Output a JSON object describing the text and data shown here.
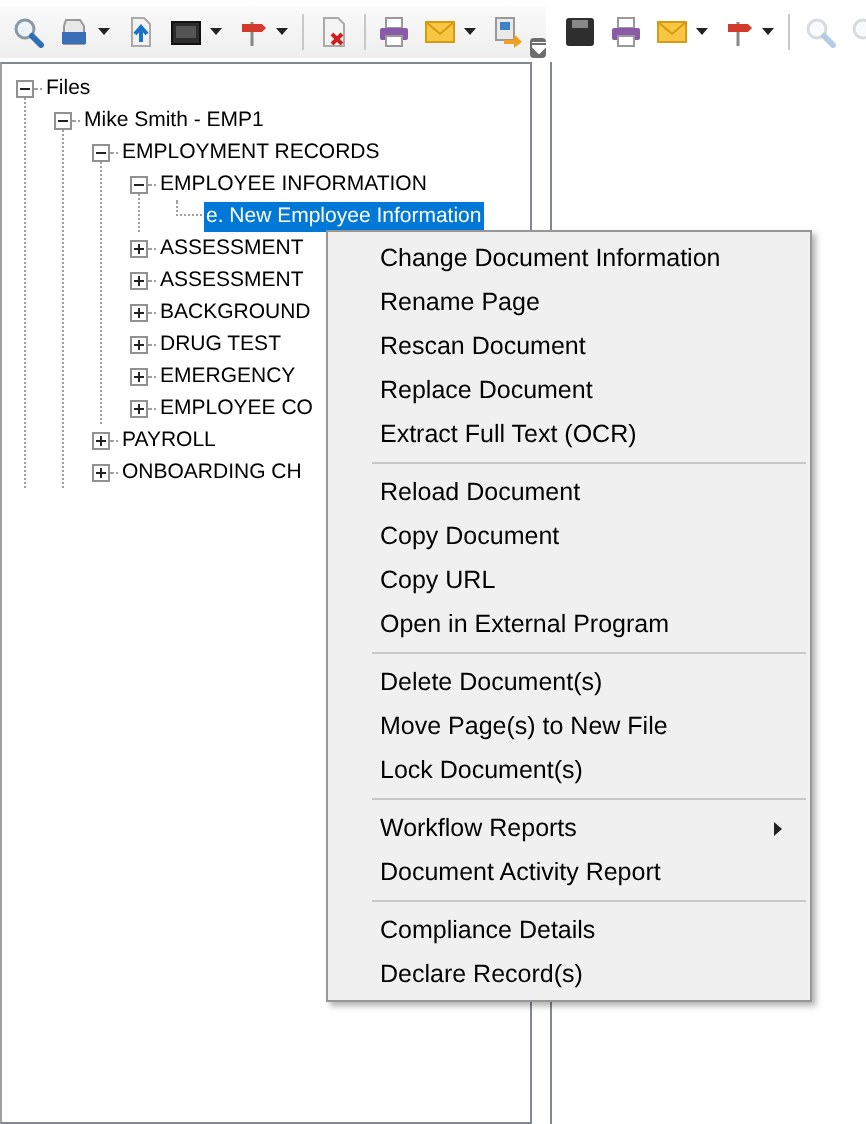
{
  "toolbar_left": [
    {
      "kind": "search",
      "dropdown": false,
      "disabled": false
    },
    {
      "kind": "scanner",
      "dropdown": true,
      "disabled": false
    },
    {
      "kind": "upload",
      "dropdown": false,
      "disabled": false
    },
    {
      "kind": "monitor",
      "dropdown": true,
      "disabled": false
    },
    {
      "kind": "signpost",
      "dropdown": true,
      "disabled": false
    },
    {
      "kind": "separator"
    },
    {
      "kind": "delete",
      "dropdown": false,
      "disabled": false
    },
    {
      "kind": "separator"
    },
    {
      "kind": "printer",
      "dropdown": false,
      "disabled": false
    },
    {
      "kind": "mail",
      "dropdown": true,
      "disabled": false
    },
    {
      "kind": "export",
      "dropdown": false,
      "disabled": false
    }
  ],
  "toolbar_right": [
    {
      "kind": "save",
      "dropdown": false,
      "disabled": false
    },
    {
      "kind": "printer",
      "dropdown": false,
      "disabled": false
    },
    {
      "kind": "mail",
      "dropdown": true,
      "disabled": false
    },
    {
      "kind": "signpost",
      "dropdown": true,
      "disabled": false
    },
    {
      "kind": "separator"
    },
    {
      "kind": "zoom-in",
      "dropdown": false,
      "disabled": true
    },
    {
      "kind": "zoom-out",
      "dropdown": false,
      "disabled": true
    }
  ],
  "tree": [
    {
      "label": "Files",
      "expanded": true,
      "selected": false,
      "children": [
        {
          "label": "Mike Smith - EMP1",
          "expanded": true,
          "selected": false,
          "children": [
            {
              "label": "EMPLOYMENT RECORDS",
              "expanded": true,
              "selected": false,
              "children": [
                {
                  "label": "EMPLOYEE INFORMATION",
                  "expanded": true,
                  "selected": false,
                  "children": [
                    {
                      "label": "e. New Employee Information",
                      "selected": true
                    }
                  ]
                },
                {
                  "label": "ASSESSMENT",
                  "expanded": false,
                  "selected": false
                },
                {
                  "label": "ASSESSMENT",
                  "expanded": false,
                  "selected": false
                },
                {
                  "label": "BACKGROUND",
                  "expanded": false,
                  "selected": false
                },
                {
                  "label": "DRUG TEST",
                  "expanded": false,
                  "selected": false
                },
                {
                  "label": "EMERGENCY",
                  "expanded": false,
                  "selected": false
                },
                {
                  "label": "EMPLOYEE CO",
                  "expanded": false,
                  "selected": false
                }
              ]
            },
            {
              "label": "PAYROLL",
              "expanded": false,
              "selected": false
            },
            {
              "label": "ONBOARDING CH",
              "expanded": false,
              "selected": false
            }
          ]
        }
      ]
    }
  ],
  "context_menu": [
    {
      "kind": "item",
      "label": "Change Document Information",
      "submenu": false
    },
    {
      "kind": "item",
      "label": "Rename Page",
      "submenu": false
    },
    {
      "kind": "item",
      "label": "Rescan Document",
      "submenu": false
    },
    {
      "kind": "item",
      "label": "Replace Document",
      "submenu": false
    },
    {
      "kind": "item",
      "label": "Extract Full Text (OCR)",
      "submenu": false
    },
    {
      "kind": "separator"
    },
    {
      "kind": "item",
      "label": "Reload Document",
      "submenu": false
    },
    {
      "kind": "item",
      "label": "Copy Document",
      "submenu": false
    },
    {
      "kind": "item",
      "label": "Copy URL",
      "submenu": false
    },
    {
      "kind": "item",
      "label": "Open in External Program",
      "submenu": false
    },
    {
      "kind": "separator"
    },
    {
      "kind": "item",
      "label": "Delete Document(s)",
      "submenu": false
    },
    {
      "kind": "item",
      "label": "Move Page(s) to New File",
      "submenu": false
    },
    {
      "kind": "item",
      "label": "Lock Document(s)",
      "submenu": false
    },
    {
      "kind": "separator"
    },
    {
      "kind": "item",
      "label": "Workflow Reports",
      "submenu": true
    },
    {
      "kind": "item",
      "label": "Document Activity Report",
      "submenu": false
    },
    {
      "kind": "separator"
    },
    {
      "kind": "item",
      "label": "Compliance Details",
      "submenu": false
    },
    {
      "kind": "item",
      "label": "Declare Record(s)",
      "submenu": false
    }
  ]
}
